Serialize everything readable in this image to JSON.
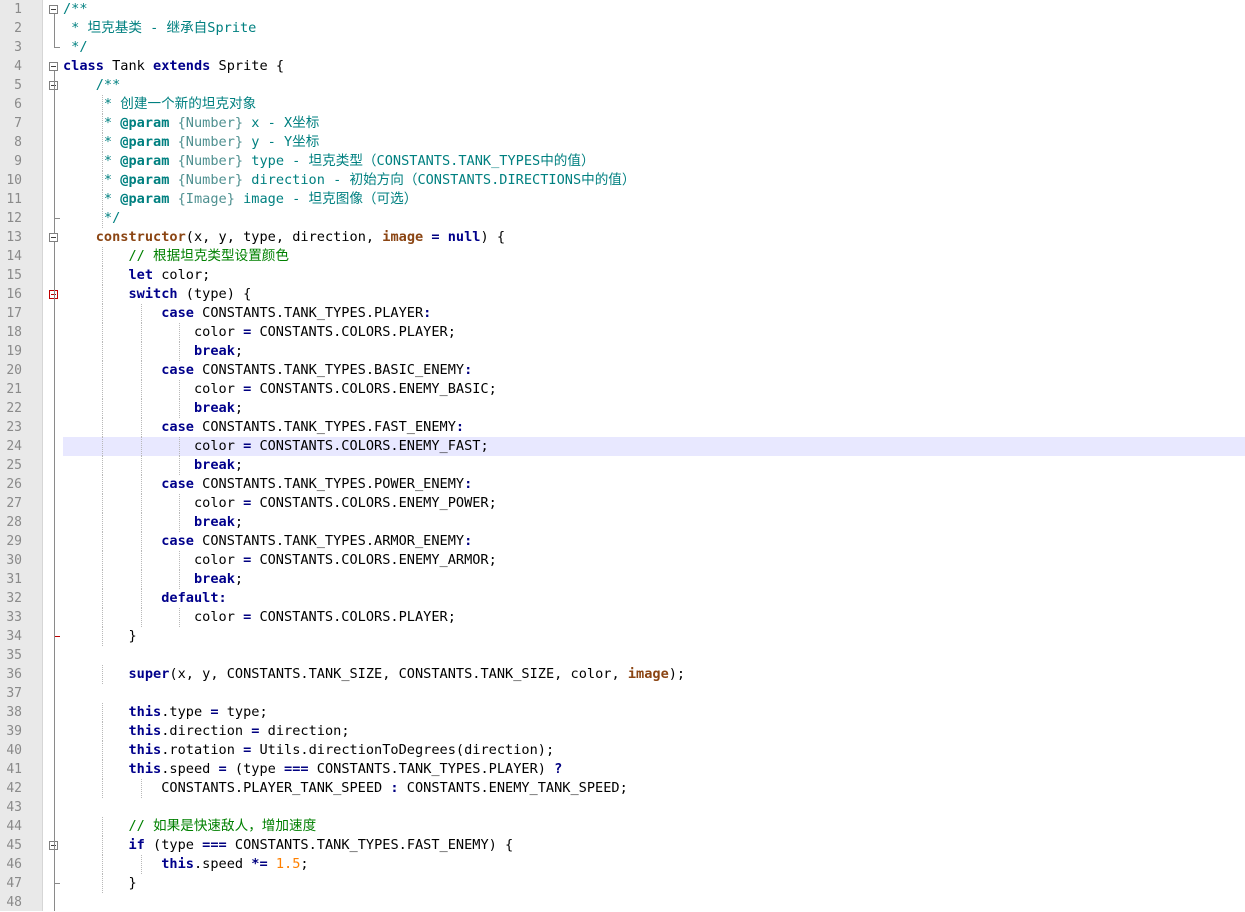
{
  "editor": {
    "language": "javascript",
    "current_line": 24,
    "colors": {
      "gutter_background": "#e9e9e9",
      "line_number": "#8a8a8a",
      "current_line_background": "#e8e8ff",
      "keyword": "#00008b",
      "comment": "#008000",
      "doc_comment": "#008080",
      "number": "#ff8000",
      "fold_marker_active": "#c00000"
    },
    "lines": [
      {
        "n": 1,
        "text": "/**"
      },
      {
        "n": 2,
        "text": " * 坦克基类 - 继承自Sprite"
      },
      {
        "n": 3,
        "text": " */"
      },
      {
        "n": 4,
        "text": "class Tank extends Sprite {"
      },
      {
        "n": 5,
        "text": "    /**"
      },
      {
        "n": 6,
        "text": "     * 创建一个新的坦克对象"
      },
      {
        "n": 7,
        "text": "     * @param {Number} x - X坐标"
      },
      {
        "n": 8,
        "text": "     * @param {Number} y - Y坐标"
      },
      {
        "n": 9,
        "text": "     * @param {Number} type - 坦克类型（CONSTANTS.TANK_TYPES中的值）"
      },
      {
        "n": 10,
        "text": "     * @param {Number} direction - 初始方向（CONSTANTS.DIRECTIONS中的值）"
      },
      {
        "n": 11,
        "text": "     * @param {Image} image - 坦克图像（可选）"
      },
      {
        "n": 12,
        "text": "     */"
      },
      {
        "n": 13,
        "text": "    constructor(x, y, type, direction, image = null) {"
      },
      {
        "n": 14,
        "text": "        // 根据坦克类型设置颜色"
      },
      {
        "n": 15,
        "text": "        let color;"
      },
      {
        "n": 16,
        "text": "        switch (type) {"
      },
      {
        "n": 17,
        "text": "            case CONSTANTS.TANK_TYPES.PLAYER:"
      },
      {
        "n": 18,
        "text": "                color = CONSTANTS.COLORS.PLAYER;"
      },
      {
        "n": 19,
        "text": "                break;"
      },
      {
        "n": 20,
        "text": "            case CONSTANTS.TANK_TYPES.BASIC_ENEMY:"
      },
      {
        "n": 21,
        "text": "                color = CONSTANTS.COLORS.ENEMY_BASIC;"
      },
      {
        "n": 22,
        "text": "                break;"
      },
      {
        "n": 23,
        "text": "            case CONSTANTS.TANK_TYPES.FAST_ENEMY:"
      },
      {
        "n": 24,
        "text": "                color = CONSTANTS.COLORS.ENEMY_FAST;"
      },
      {
        "n": 25,
        "text": "                break;"
      },
      {
        "n": 26,
        "text": "            case CONSTANTS.TANK_TYPES.POWER_ENEMY:"
      },
      {
        "n": 27,
        "text": "                color = CONSTANTS.COLORS.ENEMY_POWER;"
      },
      {
        "n": 28,
        "text": "                break;"
      },
      {
        "n": 29,
        "text": "            case CONSTANTS.TANK_TYPES.ARMOR_ENEMY:"
      },
      {
        "n": 30,
        "text": "                color = CONSTANTS.COLORS.ENEMY_ARMOR;"
      },
      {
        "n": 31,
        "text": "                break;"
      },
      {
        "n": 32,
        "text": "            default:"
      },
      {
        "n": 33,
        "text": "                color = CONSTANTS.COLORS.PLAYER;"
      },
      {
        "n": 34,
        "text": "        }"
      },
      {
        "n": 35,
        "text": ""
      },
      {
        "n": 36,
        "text": "        super(x, y, CONSTANTS.TANK_SIZE, CONSTANTS.TANK_SIZE, color, image);"
      },
      {
        "n": 37,
        "text": ""
      },
      {
        "n": 38,
        "text": "        this.type = type;"
      },
      {
        "n": 39,
        "text": "        this.direction = direction;"
      },
      {
        "n": 40,
        "text": "        this.rotation = Utils.directionToDegrees(direction);"
      },
      {
        "n": 41,
        "text": "        this.speed = (type === CONSTANTS.TANK_TYPES.PLAYER) ?"
      },
      {
        "n": 42,
        "text": "            CONSTANTS.PLAYER_TANK_SPEED : CONSTANTS.ENEMY_TANK_SPEED;"
      },
      {
        "n": 43,
        "text": ""
      },
      {
        "n": 44,
        "text": "        // 如果是快速敌人，增加速度"
      },
      {
        "n": 45,
        "text": "        if (type === CONSTANTS.TANK_TYPES.FAST_ENEMY) {"
      },
      {
        "n": 46,
        "text": "            this.speed *= 1.5;"
      },
      {
        "n": 47,
        "text": "        }"
      },
      {
        "n": 48,
        "text": ""
      }
    ]
  }
}
